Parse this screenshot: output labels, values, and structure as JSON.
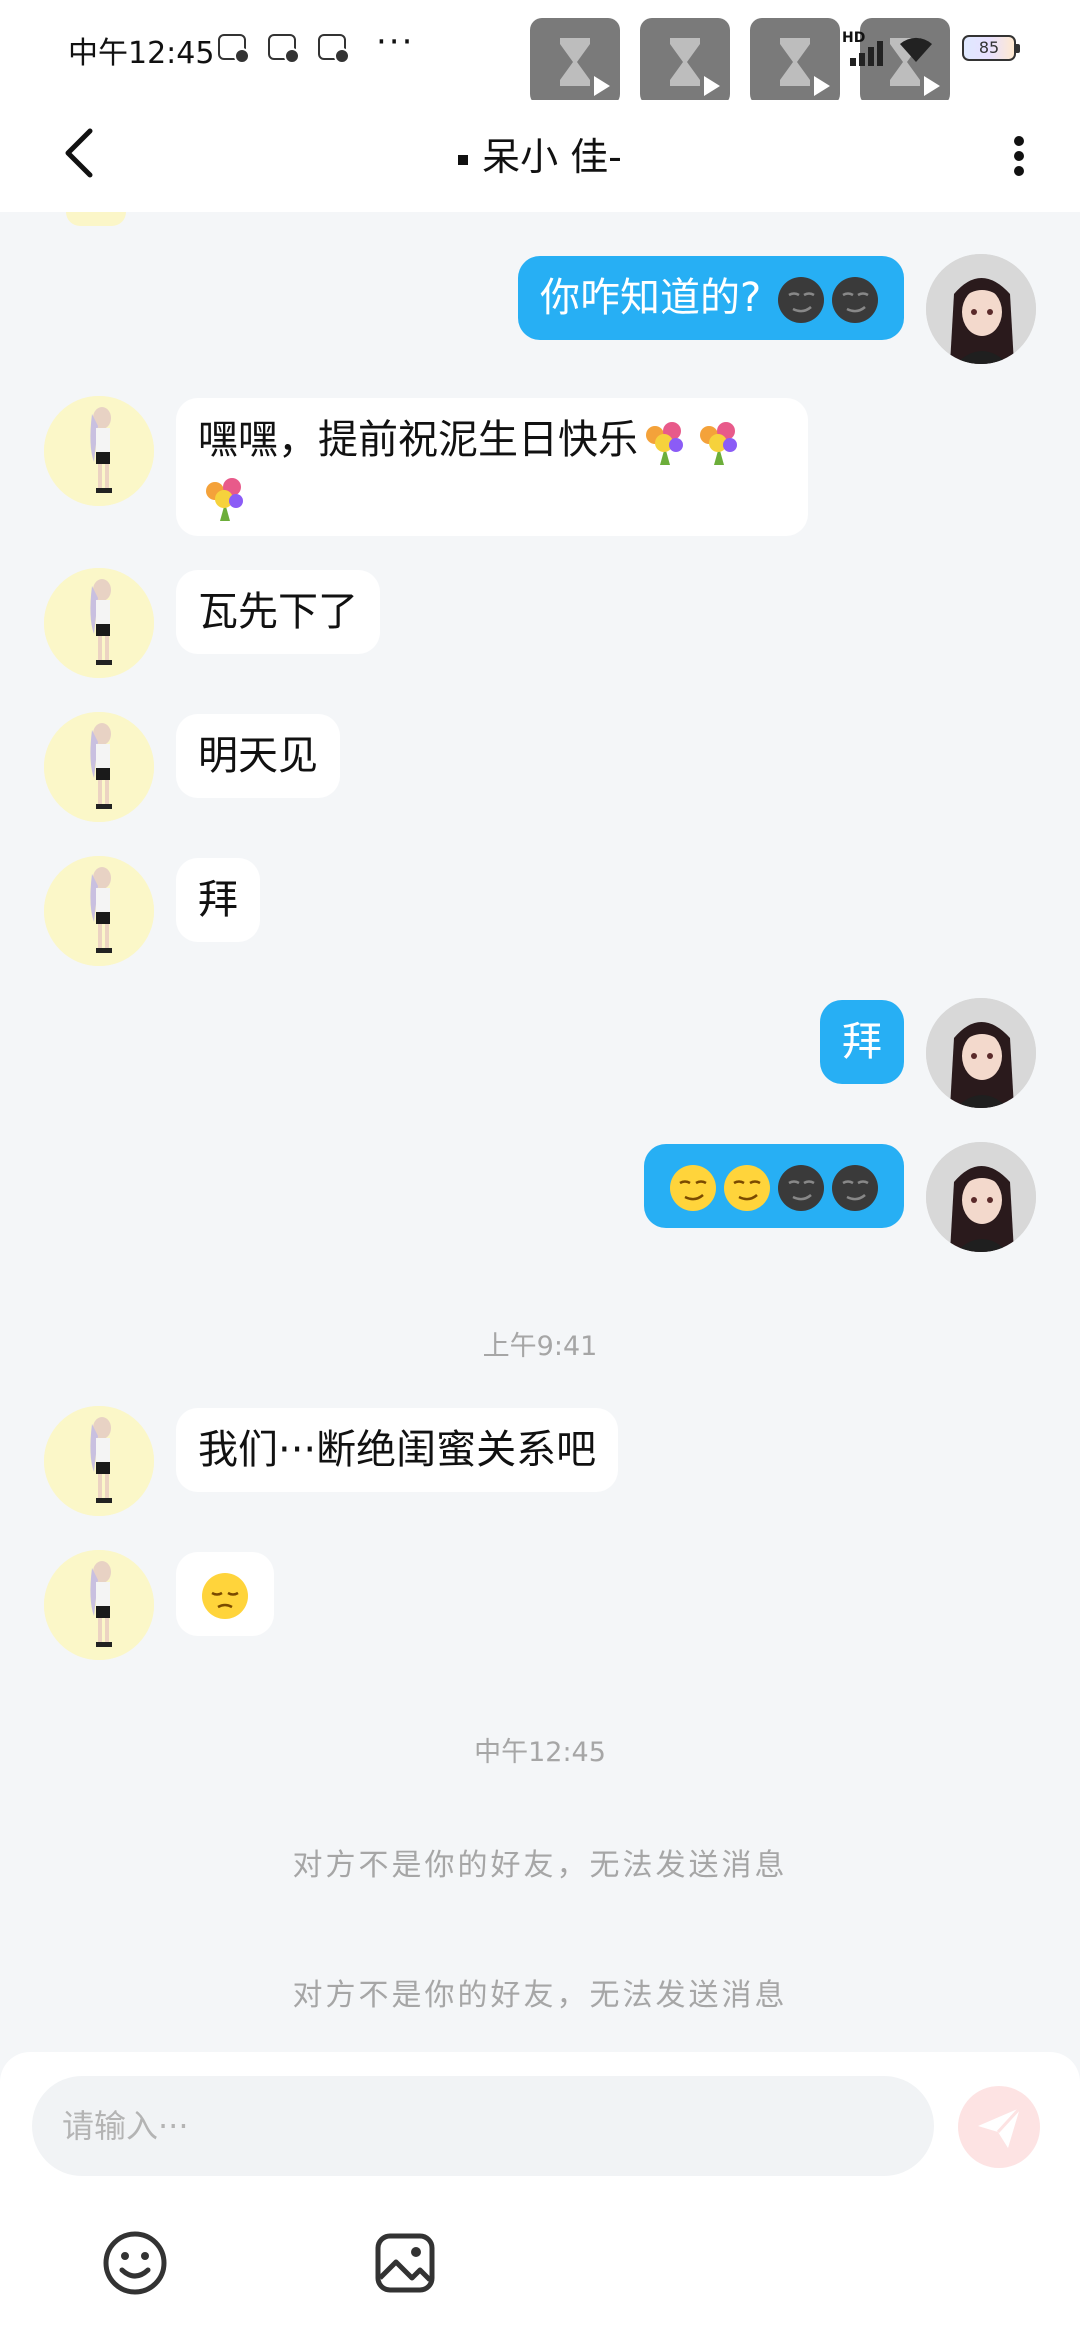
{
  "status_bar": {
    "time": "中午12:45",
    "more": "···",
    "hd_label": "HD",
    "battery": "85"
  },
  "header": {
    "title": "呆小 佳-"
  },
  "messages": [
    {
      "sender": "me",
      "text": "你咋知道的?",
      "emojis": [
        "smirk-dark-face",
        "smirk-dark-face"
      ]
    },
    {
      "sender": "other",
      "text": "嘿嘿，提前祝泥生日快乐",
      "emojis": [
        "bouquet",
        "bouquet",
        "bouquet"
      ]
    },
    {
      "sender": "other",
      "text": "瓦先下了"
    },
    {
      "sender": "other",
      "text": "明天见"
    },
    {
      "sender": "other",
      "text": "拜"
    },
    {
      "sender": "me",
      "text": "拜"
    },
    {
      "sender": "me",
      "text": "",
      "emojis": [
        "smirk-face",
        "smirk-face",
        "smirk-dark-face",
        "smirk-dark-face"
      ]
    },
    {
      "sender": "other",
      "text": "我们···断绝闺蜜关系吧"
    },
    {
      "sender": "other",
      "text": "",
      "emojis": [
        "pensive-face"
      ]
    }
  ],
  "timestamps": [
    "上午9:41",
    "中午12:45"
  ],
  "system_messages": [
    "对方不是你的好友，无法发送消息",
    "对方不是你的好友，无法发送消息"
  ],
  "input": {
    "placeholder": "请输入···"
  },
  "colors": {
    "my_bubble": "#27aff4",
    "other_bubble": "#ffffff",
    "background": "#f4f6f8",
    "send_button": "#fde3e3"
  },
  "icons": {
    "back": "chevron-left-icon",
    "menu": "more-vertical-icon",
    "send": "send-icon",
    "emoji": "smiley-icon",
    "image": "image-icon"
  }
}
